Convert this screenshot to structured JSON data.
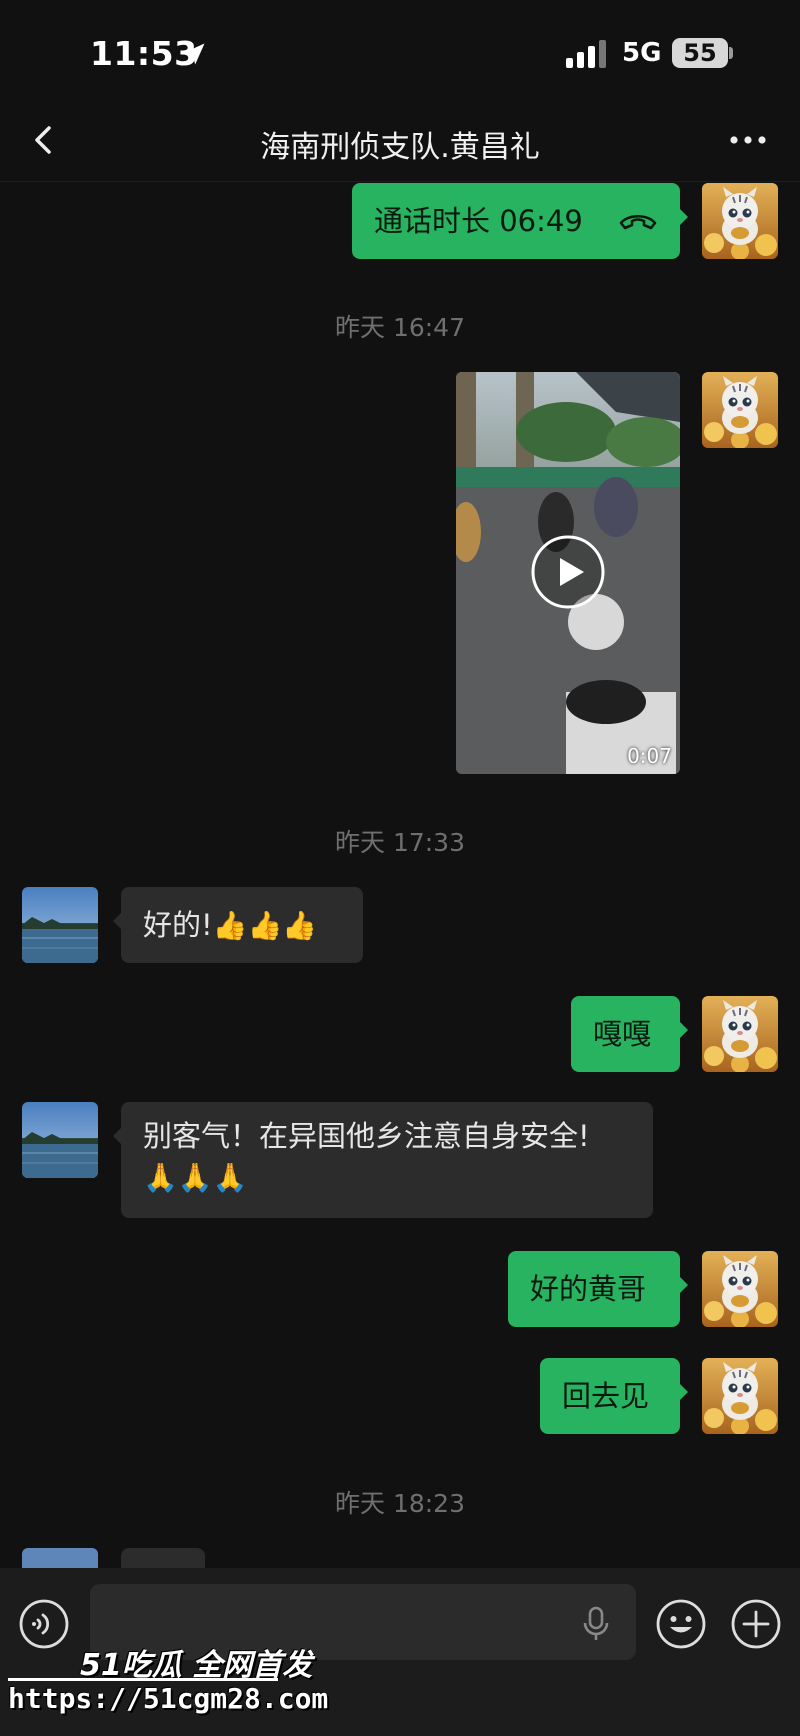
{
  "status_bar": {
    "time": "11:53",
    "network": "5G",
    "battery": "55"
  },
  "nav": {
    "title": "海南刑侦支队.黄昌礼"
  },
  "messages": {
    "call": {
      "text": "通话时长 06:49"
    },
    "ts1": "昨天 16:47",
    "video": {
      "duration": "0:07"
    },
    "ts2": "昨天 17:33",
    "in1": {
      "text": "好的!",
      "emoji": "👍👍👍"
    },
    "out2": {
      "text": "嘎嘎"
    },
    "in2": {
      "text": "别客气！在异国他乡注意自身安全!",
      "emoji": "🙏🙏🙏"
    },
    "out3": {
      "text": "好的黄哥"
    },
    "out4": {
      "text": "回去见"
    },
    "ts3": "昨天 18:23"
  },
  "input": {
    "value": ""
  },
  "watermark": {
    "brand": "51吃瓜 全网首发",
    "url": "https://51cgm28.com"
  },
  "colors": {
    "outgoing_bubble": "#27b35f",
    "incoming_bubble": "#2c2c2c",
    "background": "#111111"
  }
}
